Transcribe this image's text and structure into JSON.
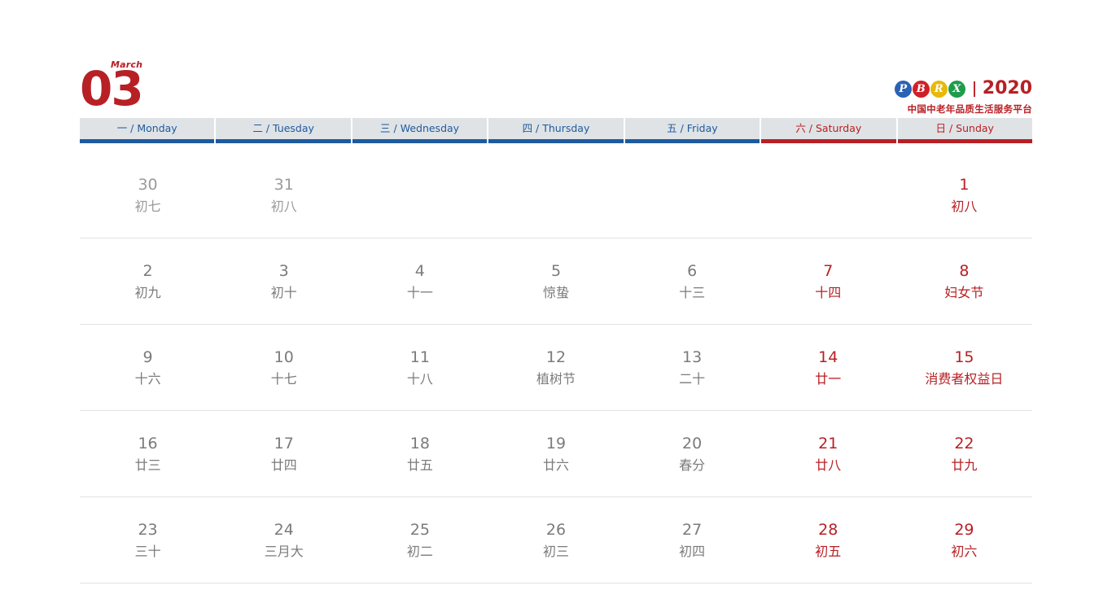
{
  "header": {
    "month_word": "March",
    "month_number": "03",
    "brand": {
      "logo_letters": [
        "P",
        "B",
        "R",
        "X"
      ],
      "logo_colors": [
        "#2b62b5",
        "#cf2027",
        "#e8b90b",
        "#1e9c4a"
      ],
      "divider": "|",
      "year": "2020",
      "tagline": "中国中老年品质生活服务平台"
    }
  },
  "colors": {
    "accent_red": "#b72025",
    "accent_blue": "#1f5a9e",
    "header_bg": "#dfe3e6",
    "muted_text": "#9a9a9a",
    "body_text": "#7b7b7b"
  },
  "weekdays": [
    {
      "label": "一 / Monday",
      "weekend": false
    },
    {
      "label": "二 / Tuesday",
      "weekend": false
    },
    {
      "label": "三 / Wednesday",
      "weekend": false
    },
    {
      "label": "四 / Thursday",
      "weekend": false
    },
    {
      "label": "五 / Friday",
      "weekend": false
    },
    {
      "label": "六 / Saturday",
      "weekend": true
    },
    {
      "label": "日 / Sunday",
      "weekend": true
    }
  ],
  "weeks": [
    [
      {
        "num": "30",
        "sub": "初七",
        "style": "muted"
      },
      {
        "num": "31",
        "sub": "初八",
        "style": "muted"
      },
      {
        "num": "",
        "sub": "",
        "style": "empty"
      },
      {
        "num": "",
        "sub": "",
        "style": "empty"
      },
      {
        "num": "",
        "sub": "",
        "style": "empty"
      },
      {
        "num": "",
        "sub": "",
        "style": "empty"
      },
      {
        "num": "1",
        "sub": "初八",
        "style": "red"
      }
    ],
    [
      {
        "num": "2",
        "sub": "初九",
        "style": "normal"
      },
      {
        "num": "3",
        "sub": "初十",
        "style": "normal"
      },
      {
        "num": "4",
        "sub": "十一",
        "style": "normal"
      },
      {
        "num": "5",
        "sub": "惊蛰",
        "style": "normal"
      },
      {
        "num": "6",
        "sub": "十三",
        "style": "normal"
      },
      {
        "num": "7",
        "sub": "十四",
        "style": "red"
      },
      {
        "num": "8",
        "sub": "妇女节",
        "style": "red"
      }
    ],
    [
      {
        "num": "9",
        "sub": "十六",
        "style": "normal"
      },
      {
        "num": "10",
        "sub": "十七",
        "style": "normal"
      },
      {
        "num": "11",
        "sub": "十八",
        "style": "normal"
      },
      {
        "num": "12",
        "sub": "植树节",
        "style": "normal"
      },
      {
        "num": "13",
        "sub": "二十",
        "style": "normal"
      },
      {
        "num": "14",
        "sub": "廿一",
        "style": "red"
      },
      {
        "num": "15",
        "sub": "消费者权益日",
        "style": "red"
      }
    ],
    [
      {
        "num": "16",
        "sub": "廿三",
        "style": "normal"
      },
      {
        "num": "17",
        "sub": "廿四",
        "style": "normal"
      },
      {
        "num": "18",
        "sub": "廿五",
        "style": "normal"
      },
      {
        "num": "19",
        "sub": "廿六",
        "style": "normal"
      },
      {
        "num": "20",
        "sub": "春分",
        "style": "normal"
      },
      {
        "num": "21",
        "sub": "廿八",
        "style": "red"
      },
      {
        "num": "22",
        "sub": "廿九",
        "style": "red"
      }
    ],
    [
      {
        "num": "23",
        "sub": "三十",
        "style": "normal"
      },
      {
        "num": "24",
        "sub": "三月大",
        "style": "normal"
      },
      {
        "num": "25",
        "sub": "初二",
        "style": "normal"
      },
      {
        "num": "26",
        "sub": "初三",
        "style": "normal"
      },
      {
        "num": "27",
        "sub": "初四",
        "style": "normal"
      },
      {
        "num": "28",
        "sub": "初五",
        "style": "red"
      },
      {
        "num": "29",
        "sub": "初六",
        "style": "red"
      }
    ]
  ]
}
